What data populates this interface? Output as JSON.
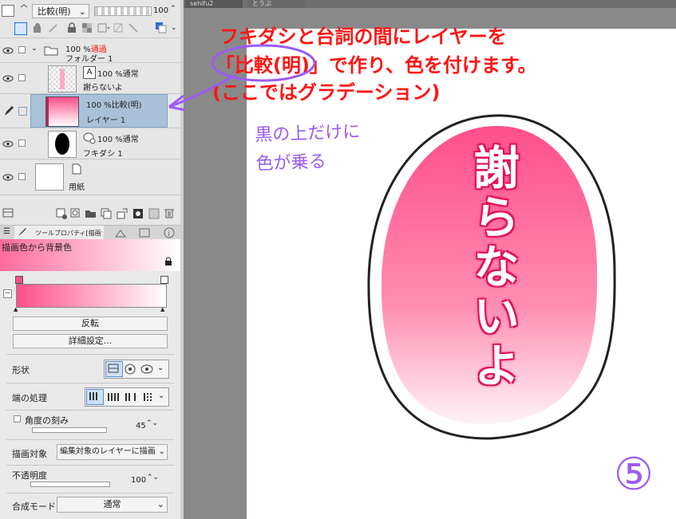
{
  "toolbar": {
    "blend_mode": "比較(明)",
    "opacity": "100",
    "opacity_arrow": "^"
  },
  "layers": [
    {
      "pct": "100 %",
      "mode": "通過",
      "name": "フォルダー 1"
    },
    {
      "pct": "100 %",
      "mode": "通常",
      "name": "謝らないよ"
    },
    {
      "pct": "100 %",
      "mode": "比較(明)",
      "name": "レイヤー 1"
    },
    {
      "pct": "100 %",
      "mode": "通常",
      "name": "フキダシ 1"
    },
    {
      "name": "用紙"
    }
  ],
  "tool_props": {
    "tab_label": "ツールプロパティ[描画色",
    "gradient_name": "描画色から背景色",
    "reverse_button": "反転",
    "detail_button": "詳細設定...",
    "shape_label": "形状",
    "edge_label": "端の処理",
    "angle_label": "角度の刻み",
    "angle_value": "45",
    "target_label": "描画対象",
    "target_value": "編集対象のレイヤーに描画",
    "opacity_label": "不透明度",
    "opacity_value": "100",
    "blend_label": "合成モード",
    "blend_value": "通常"
  },
  "canvas_tabs": [
    "sehifu2",
    "とうぶ"
  ],
  "annotation": {
    "line1": "フキダシと台詞の間にレイヤーを",
    "line2": "「比較(明)」で作り、色を付けます。",
    "line3": "(ここではグラデーション)",
    "handwritten": "黒の上だけに 色が乗る",
    "step": "⑤"
  },
  "artwork": {
    "speech_text": "謝らないよ"
  },
  "colors": {
    "accent_pink": "#ff4f8a",
    "annotation_red": "#ff1414",
    "handwriting_purple": "#9a5cf0"
  }
}
